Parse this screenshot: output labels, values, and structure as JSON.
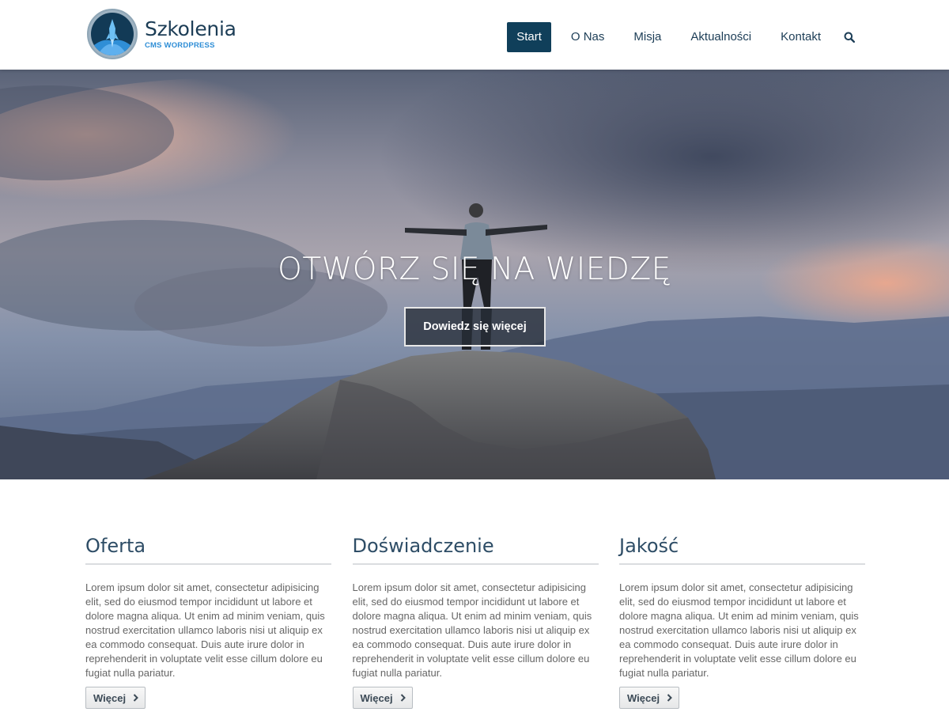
{
  "brand": {
    "title": "Szkolenia",
    "subtitle": "CMS WORDPRESS",
    "logo_icon": "rocket-icon"
  },
  "nav": {
    "items": [
      {
        "label": "Start",
        "active": true
      },
      {
        "label": "O Nas",
        "active": false
      },
      {
        "label": "Misja",
        "active": false
      },
      {
        "label": "Aktualności",
        "active": false
      },
      {
        "label": "Kontakt",
        "active": false
      }
    ],
    "search_icon": "search-icon"
  },
  "hero": {
    "title": "OTWÓRZ SIĘ NA WIEDZĘ",
    "button_label": "Dowiedz się więcej"
  },
  "features": [
    {
      "title": "Oferta",
      "text": "Lorem ipsum dolor sit amet, consectetur adipisicing elit, sed do eiusmod tempor incididunt ut labore et dolore magna aliqua. Ut enim ad minim veniam, quis nostrud exercitation ullamco laboris nisi ut aliquip ex ea commodo consequat. Duis aute irure dolor in reprehenderit in voluptate velit esse cillum dolore eu fugiat nulla pariatur.",
      "button_label": "Więcej"
    },
    {
      "title": "Doświadczenie",
      "text": "Lorem ipsum dolor sit amet, consectetur adipisicing elit, sed do eiusmod tempor incididunt ut labore et dolore magna aliqua. Ut enim ad minim veniam, quis nostrud exercitation ullamco laboris nisi ut aliquip ex ea commodo consequat. Duis aute irure dolor in reprehenderit in voluptate velit esse cillum dolore eu fugiat nulla pariatur.",
      "button_label": "Więcej"
    },
    {
      "title": "Jakość",
      "text": "Lorem ipsum dolor sit amet, consectetur adipisicing elit, sed do eiusmod tempor incididunt ut labore et dolore magna aliqua. Ut enim ad minim veniam, quis nostrud exercitation ullamco laboris nisi ut aliquip ex ea commodo consequat. Duis aute irure dolor in reprehenderit in voluptate velit esse cillum dolore eu fugiat nulla pariatur.",
      "button_label": "Więcej"
    }
  ],
  "colors": {
    "nav_active_bg": "#103f5a",
    "brand_dark": "#1c3d56",
    "brand_accent": "#2f8ed6"
  }
}
